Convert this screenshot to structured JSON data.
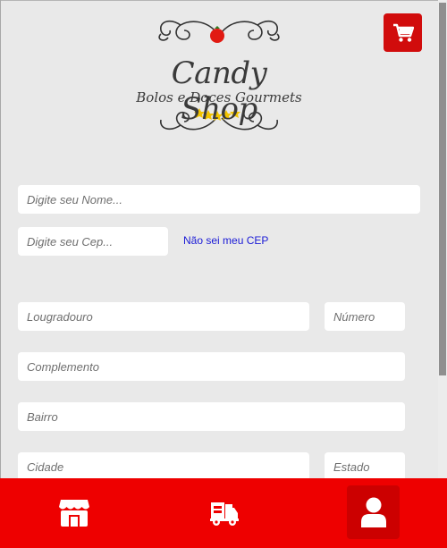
{
  "brand": {
    "title": "Candy Shop",
    "subtitle": "Bolos e Doces Gourmets"
  },
  "form": {
    "name_placeholder": "Digite seu Nome...",
    "cep_placeholder": "Digite seu Cep...",
    "cep_link": "Não sei meu CEP",
    "street_placeholder": "Lougradouro",
    "number_placeholder": "Número",
    "complement_placeholder": "Complemento",
    "district_placeholder": "Bairro",
    "city_placeholder": "Cidade",
    "state_placeholder": "Estado"
  },
  "icons": {
    "cart": "cart-icon",
    "store": "store-icon",
    "delivery": "delivery-truck-icon",
    "profile": "user-icon"
  },
  "colors": {
    "accent": "#ee0000",
    "cart_bg": "#d10c0c",
    "background": "#e9e9e9",
    "link": "#1a1ad6"
  }
}
